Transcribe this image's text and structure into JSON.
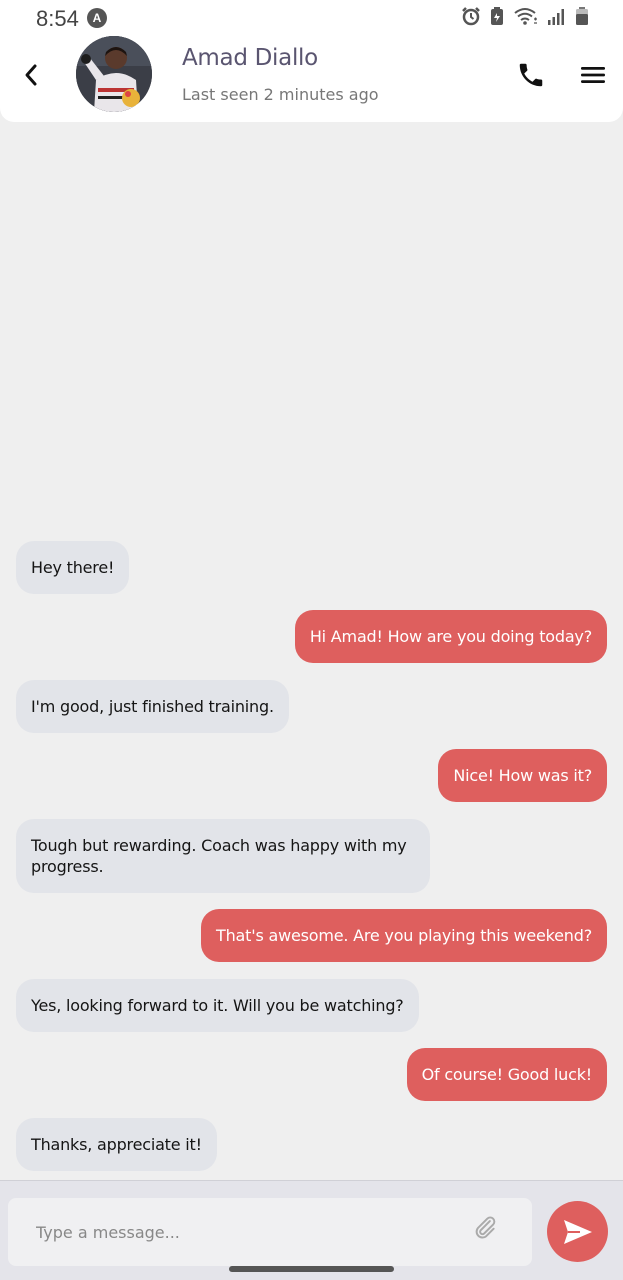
{
  "status_bar": {
    "time": "8:54",
    "app_icon": "A",
    "icons": [
      "alarm-icon",
      "battery-saver-icon",
      "wifi-icon",
      "signal-icon",
      "battery-icon"
    ]
  },
  "header": {
    "contact_name": "Amad Diallo",
    "last_seen": "Last seen 2 minutes ago",
    "icons": [
      "back-chevron-icon",
      "phone-icon",
      "hamburger-menu-icon"
    ]
  },
  "messages": [
    {
      "direction": "in",
      "text": "Hey there!"
    },
    {
      "direction": "out",
      "text": "Hi Amad! How are you doing today?"
    },
    {
      "direction": "in",
      "text": "I'm good, just finished training."
    },
    {
      "direction": "out",
      "text": "Nice! How was it?"
    },
    {
      "direction": "in",
      "text": "Tough but rewarding. Coach was happy with my progress."
    },
    {
      "direction": "out",
      "text": "That's awesome. Are you playing this weekend?"
    },
    {
      "direction": "in",
      "text": "Yes, looking forward to it. Will you be watching?"
    },
    {
      "direction": "out",
      "text": "Of course! Good luck!"
    },
    {
      "direction": "in",
      "text": "Thanks, appreciate it!"
    }
  ],
  "composer": {
    "placeholder": "Type a message...",
    "value": "",
    "icons": [
      "paperclip-icon",
      "send-icon"
    ]
  },
  "colors": {
    "accent": "#de5f5e",
    "incoming_bubble": "#e2e4e9",
    "background": "#efefef",
    "name_color": "#5a5570"
  }
}
